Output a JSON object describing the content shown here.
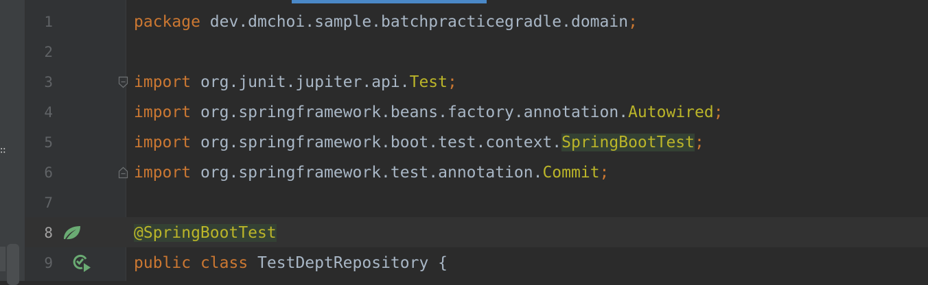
{
  "colors": {
    "background": "#2b2b2b",
    "gutter": "#313335",
    "keyword": "#cc7832",
    "class_reference": "#bbb529",
    "plain_text": "#a9b7c6",
    "line_number": "#606366",
    "usage_highlight": "#344134",
    "spring_icon": "#6aab73",
    "active_tab_indicator": "#4a88c7"
  },
  "editor": {
    "lines": [
      {
        "num": "1",
        "parts": [
          {
            "text": "package",
            "style": "kw"
          },
          {
            "text": " dev.dmchoi.sample.batchpracticegradle.domain",
            "style": "plain"
          },
          {
            "text": ";",
            "style": "kw"
          }
        ]
      },
      {
        "num": "2",
        "parts": []
      },
      {
        "num": "3",
        "fold": "start",
        "parts": [
          {
            "text": "import",
            "style": "kw"
          },
          {
            "text": " org.junit.jupiter.api.",
            "style": "plain"
          },
          {
            "text": "Test",
            "style": "cls"
          },
          {
            "text": ";",
            "style": "kw"
          }
        ]
      },
      {
        "num": "4",
        "parts": [
          {
            "text": "import",
            "style": "kw"
          },
          {
            "text": " org.springframework.beans.factory.annotation.",
            "style": "plain"
          },
          {
            "text": "Autowired",
            "style": "cls"
          },
          {
            "text": ";",
            "style": "kw"
          }
        ]
      },
      {
        "num": "5",
        "parts": [
          {
            "text": "import",
            "style": "kw"
          },
          {
            "text": " org.springframework.boot.test.context.",
            "style": "plain"
          },
          {
            "text": "SpringBootTest",
            "style": "cls-hl"
          },
          {
            "text": ";",
            "style": "kw"
          }
        ]
      },
      {
        "num": "6",
        "fold": "end",
        "parts": [
          {
            "text": "import",
            "style": "kw"
          },
          {
            "text": " org.springframework.test.annotation.",
            "style": "plain"
          },
          {
            "text": "Commit",
            "style": "cls"
          },
          {
            "text": ";",
            "style": "kw"
          }
        ]
      },
      {
        "num": "7",
        "parts": []
      },
      {
        "num": "8",
        "current": true,
        "gutter_icon": "spring-bean-icon",
        "parts": [
          {
            "text": "@SpringBootTest",
            "style": "anno-hl"
          }
        ]
      },
      {
        "num": "9",
        "gutter_icon": "run-test-icon",
        "parts": [
          {
            "text": "public",
            "style": "kw"
          },
          {
            "text": " ",
            "style": "plain"
          },
          {
            "text": "class",
            "style": "kw"
          },
          {
            "text": " TestDeptRepository {",
            "style": "plain"
          }
        ]
      }
    ]
  }
}
